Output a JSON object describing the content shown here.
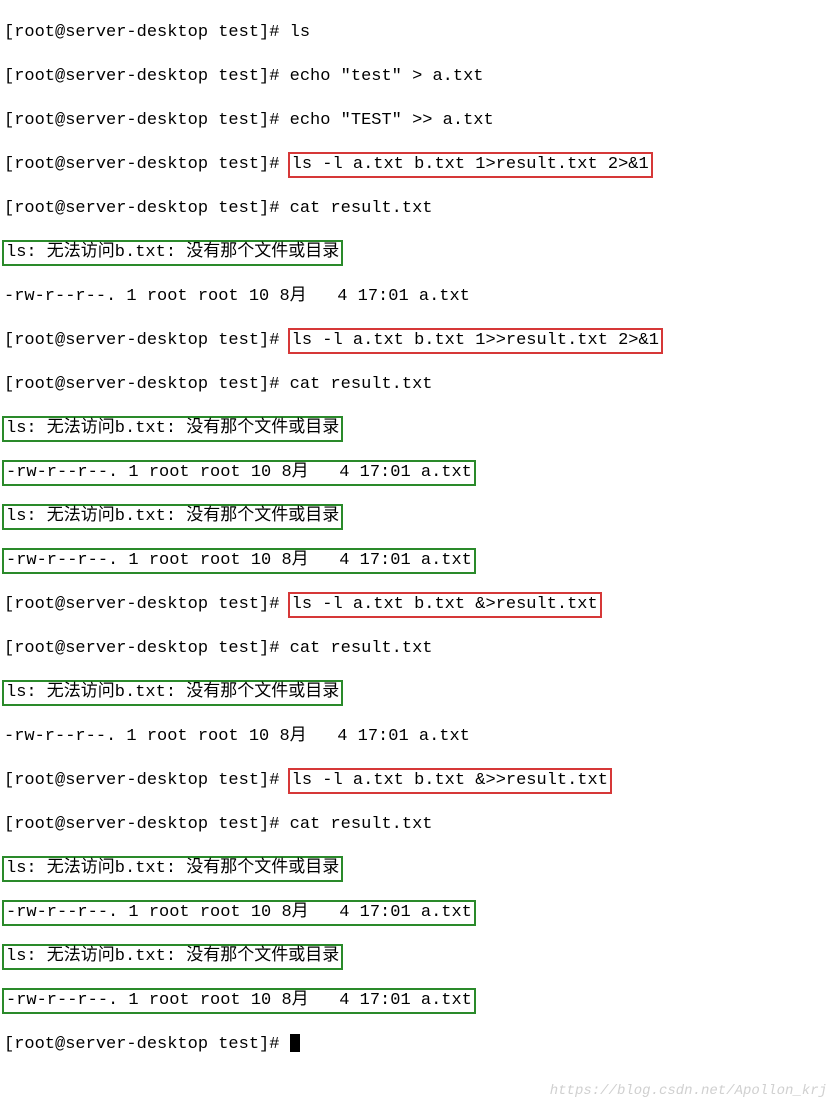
{
  "prompt": "[root@server-desktop test]# ",
  "cmds": {
    "ls": "ls",
    "echo1": "echo \"test\" > a.txt",
    "echo2": "echo \"TEST\" >> a.txt",
    "ls1": "ls -l a.txt b.txt 1>result.txt 2>&1",
    "cat": "cat result.txt",
    "ls2": "ls -l a.txt b.txt 1>>result.txt 2>&1",
    "ls3": "ls -l a.txt b.txt &>result.txt",
    "ls4": "ls -l a.txt b.txt &>>result.txt"
  },
  "out": {
    "err": "ls: 无法访问b.txt: 没有那个文件或目录",
    "stat": "-rw-r--r--. 1 root root 10 8月   4 17:01 a.txt"
  },
  "watermark": "https://blog.csdn.net/Apollon_krj"
}
